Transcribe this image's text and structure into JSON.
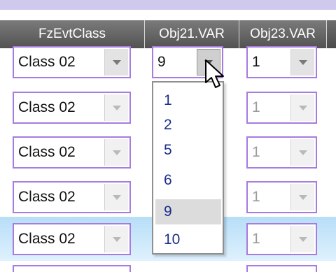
{
  "header": {
    "columns": [
      "FzEvtClass",
      "Obj21.VAR",
      "Obj23.VAR"
    ]
  },
  "rows": [
    {
      "fz_class": "Class 02",
      "obj21": "9",
      "obj23": "1"
    },
    {
      "fz_class": "Class 02",
      "obj21": "",
      "obj23": "1"
    },
    {
      "fz_class": "Class 02",
      "obj21": "",
      "obj23": "1"
    },
    {
      "fz_class": "Class 02",
      "obj21": "",
      "obj23": "1"
    },
    {
      "fz_class": "Class 02",
      "obj21": "",
      "obj23": "1"
    }
  ],
  "obj21_dropdown": {
    "options": [
      "1",
      "2",
      "5",
      "6",
      "9",
      "10"
    ],
    "selected": "9"
  },
  "colors": {
    "combo_border": "#a77be0",
    "option_text": "#1b2f8a",
    "selected_row": "#b7def8",
    "header_bg": "#5f5f5f"
  },
  "icons": {
    "dropdown": "chevron-down-icon",
    "pointer": "mouse-pointer-icon"
  }
}
